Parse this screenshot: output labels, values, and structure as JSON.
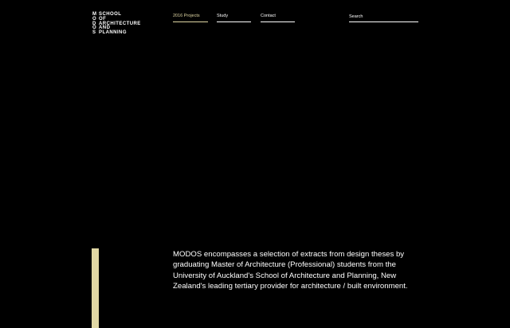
{
  "logo": {
    "rows": [
      {
        "letter": "M",
        "word": "SCHOOL"
      },
      {
        "letter": "O",
        "word": "OF"
      },
      {
        "letter": "D",
        "word": "ARCHITECTURE"
      },
      {
        "letter": "O",
        "word": "AND"
      },
      {
        "letter": "S",
        "word": "PLANNING"
      }
    ]
  },
  "nav": {
    "items": [
      {
        "label": "2016 Projects",
        "active": true
      },
      {
        "label": "Study",
        "active": false
      },
      {
        "label": "Contact",
        "active": false
      }
    ]
  },
  "search": {
    "placeholder": "Search",
    "value": ""
  },
  "intro": {
    "text": "MODOS encompasses a selection of extracts from design theses by graduating Master of Architecture (Professional) students from the University of Auckland's School of Architecture and Planning, New Zealand's leading tertiary provider for architecture / built environment."
  },
  "colors": {
    "background": "#000000",
    "text": "#ffffff",
    "accent": "#e0d7a4"
  }
}
